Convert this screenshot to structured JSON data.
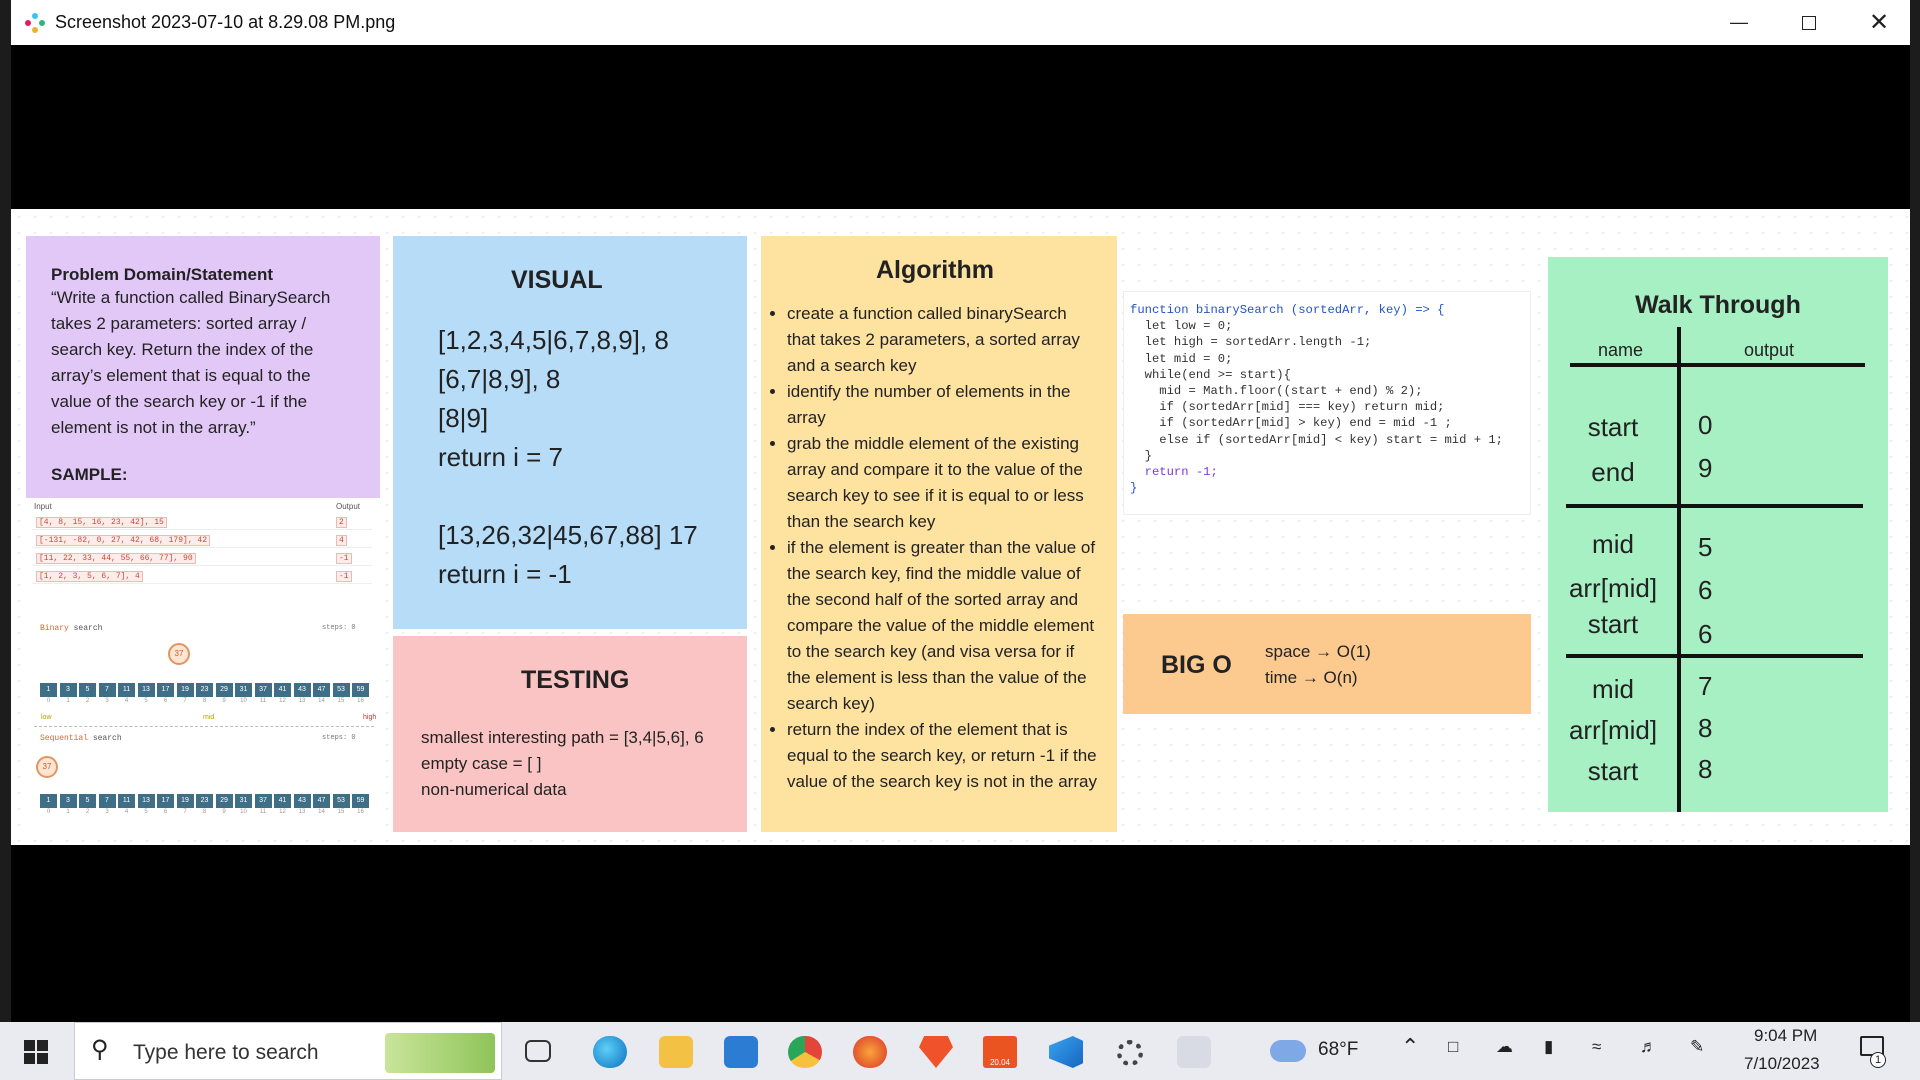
{
  "window": {
    "title": "Screenshot 2023-07-10 at 8.29.08 PM.png"
  },
  "problem": {
    "heading": "Problem Domain/Statement",
    "text": "“Write a function called BinarySearch takes 2 parameters: sorted array / search key.  Return the index of the array’s element that is equal to the value of the search key or -1 if the element is not in the array.”",
    "sample_label": "SAMPLE:"
  },
  "sample": {
    "input_header": "Input",
    "output_header": "Output",
    "rows": [
      {
        "input": "[4, 8, 15, 16, 23, 42], 15",
        "output": "2"
      },
      {
        "input": "[-131, -82, 0, 27, 42, 68, 179], 42",
        "output": "4"
      },
      {
        "input": "[11, 22, 33, 44, 55, 66, 77], 90",
        "output": "-1"
      },
      {
        "input": "[1, 2, 3, 5, 6, 7], 4",
        "output": "-1"
      }
    ],
    "binary_label": "Binary",
    "search_word": "search",
    "steps_label": "steps: 0",
    "sequential_label": "Sequential",
    "target": "37",
    "cells": [
      "1",
      "3",
      "5",
      "7",
      "11",
      "13",
      "17",
      "19",
      "23",
      "29",
      "31",
      "37",
      "41",
      "43",
      "47",
      "53",
      "59"
    ],
    "low": "low",
    "mid": "mid",
    "high": "high"
  },
  "visual": {
    "heading": "VISUAL",
    "lines": [
      "[1,2,3,4,5|6,7,8,9], 8",
      "[6,7|8,9], 8",
      "[8|9]",
      "return i = 7",
      "",
      "[13,26,32|45,67,88] 17",
      "return i = -1"
    ]
  },
  "testing": {
    "heading": "TESTING",
    "lines": [
      "smallest interesting path = [3,4|5,6], 6",
      "empty case = [ ]",
      "non-numerical data"
    ]
  },
  "algorithm": {
    "heading": "Algorithm",
    "items": [
      "create a function called binarySearch that takes 2 parameters, a sorted array and a search key",
      "identify the number of elements in the array",
      "grab the middle element of the existing array and compare it to the value of the search key to see if it is equal to or less than the search key",
      "if the element is greater than the value of the search key, find the middle value of the second half of the sorted array and compare the value of the middle element to the search key (and visa versa for if the element is less than the value of the search key)",
      "return the index of the element that is equal to the search key, or return -1 if the value of the search key is not in the array"
    ]
  },
  "code": {
    "lines": [
      "function binarySearch (sortedArr, key) => {",
      "  let low = 0;",
      "  let high = sortedArr.length -1;",
      "  let mid = 0;",
      "  while(end >= start){",
      "    mid = Math.floor((start + end) % 2);",
      "    if (sortedArr[mid] === key) return mid;",
      "    if (sortedArr[mid] > key) end = mid -1 ;",
      "    else if (sortedArr[mid] < key) start = mid + 1;",
      "  }",
      "  return -1;",
      "}"
    ]
  },
  "bigo": {
    "heading": "BIG O",
    "space": "space → O(1)",
    "time": "time → O(n)"
  },
  "walkthrough": {
    "heading": "Walk Through",
    "col_name": "name",
    "col_output": "output",
    "rows": [
      {
        "name": "start",
        "value": "0"
      },
      {
        "name": "end",
        "value": "9"
      },
      {
        "name": "mid",
        "value": "5"
      },
      {
        "name": "arr[mid]",
        "value": "6"
      },
      {
        "name": "start",
        "value": "6"
      },
      {
        "name": "mid",
        "value": "7"
      },
      {
        "name": "arr[mid]",
        "value": "8"
      },
      {
        "name": "start",
        "value": "8"
      }
    ]
  },
  "taskbar": {
    "search_placeholder": "Type here to search",
    "weather": "68°F",
    "time": "9:04 PM",
    "date": "7/10/2023",
    "notification_count": "1",
    "ubuntu_badge": "20.04"
  }
}
